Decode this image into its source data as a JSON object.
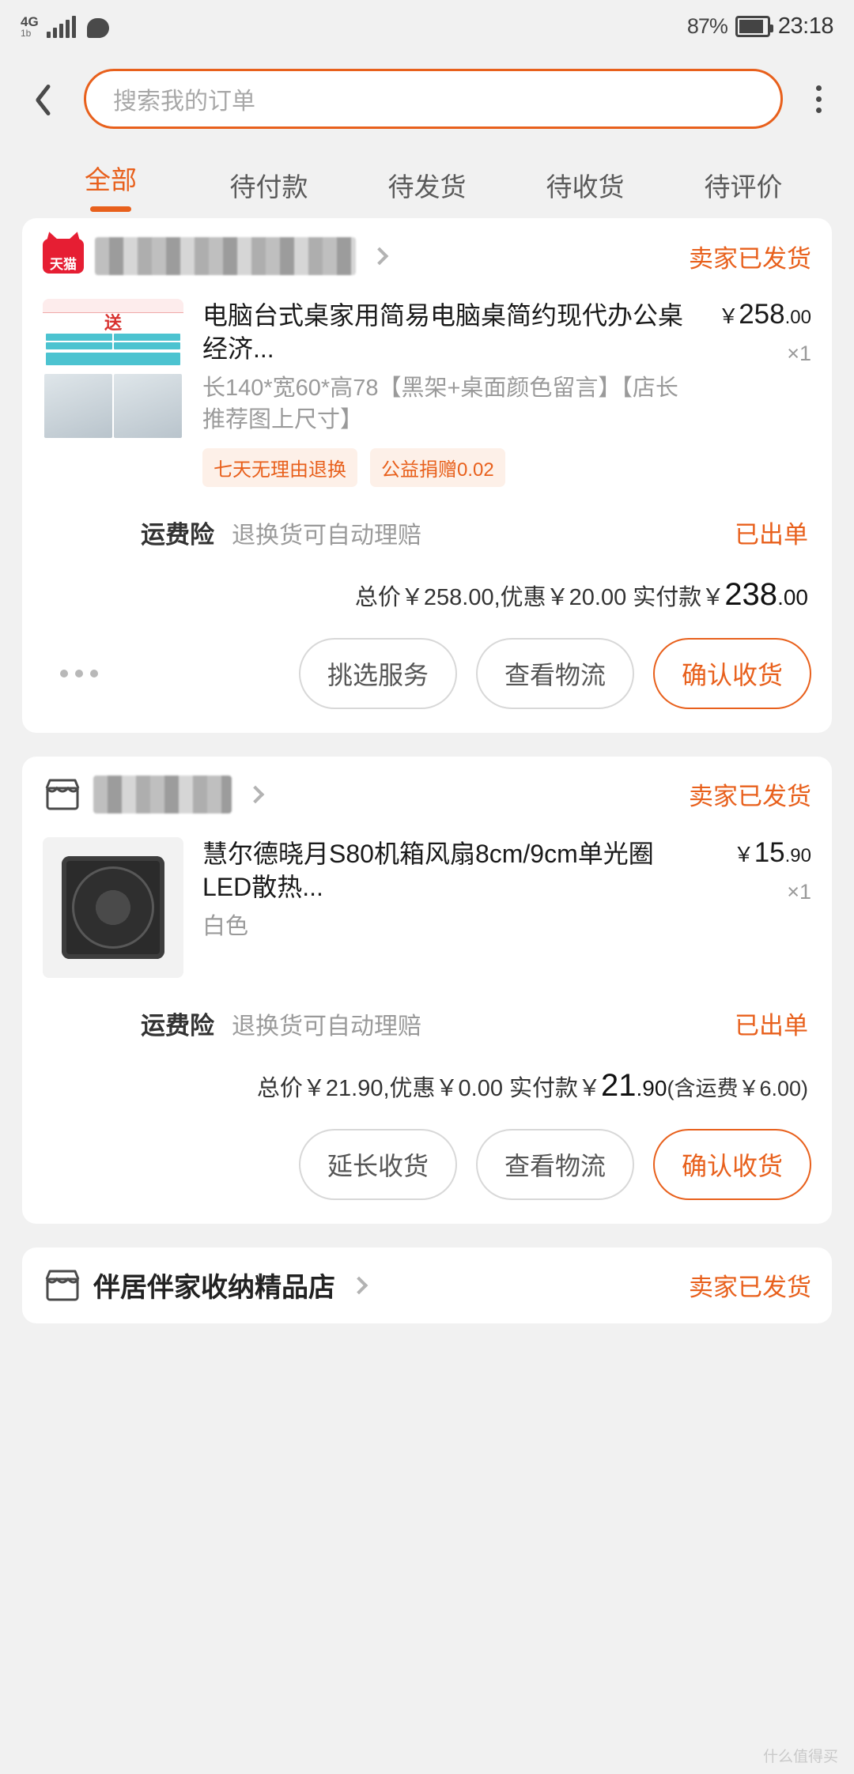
{
  "status_bar": {
    "network": "4G",
    "network_sub": "1b",
    "battery_percent": "87%",
    "battery_level": 87,
    "time": "23:18"
  },
  "header": {
    "back_icon": "back-arrow-icon",
    "search_placeholder": "搜索我的订单",
    "menu_icon": "kebab-menu-icon",
    "accent_color": "#e8601c"
  },
  "tabs": [
    {
      "label": "全部",
      "active": true
    },
    {
      "label": "待付款",
      "active": false
    },
    {
      "label": "待发货",
      "active": false
    },
    {
      "label": "待收货",
      "active": false
    },
    {
      "label": "待评价",
      "active": false
    }
  ],
  "orders": [
    {
      "shop": {
        "badge": "tmall-badge",
        "badge_text": "天猫",
        "name_hidden": true,
        "status": "卖家已发货"
      },
      "product": {
        "title": "电脑台式桌家用简易电脑桌简约现代办公桌经济...",
        "spec": "长140*宽60*高78【黑架+桌面颜色留言】【店长推荐图上尺寸】",
        "price_yen": "￥",
        "price_int": "258",
        "price_cents": ".00",
        "qty": "×1",
        "tags": [
          "七天无理由退换",
          "公益捐赠0.02"
        ]
      },
      "insurance": {
        "title": "运费险",
        "desc": "退换货可自动理赔",
        "state": "已出单"
      },
      "totals": {
        "prefix": "总价￥258.00,优惠￥20.00 实付款￥",
        "paid_int": "238",
        "paid_cents": ".00",
        "shipping_note": ""
      },
      "actions": {
        "more": "more-options",
        "buttons": [
          "挑选服务",
          "查看物流"
        ],
        "primary": "确认收货"
      }
    },
    {
      "shop": {
        "badge": "store-icon",
        "badge_text": "",
        "name_hidden": true,
        "status": "卖家已发货"
      },
      "product": {
        "title": "慧尔德晓月S80机箱风扇8cm/9cm单光圈LED散热...",
        "spec": "白色",
        "price_yen": "￥",
        "price_int": "15",
        "price_cents": ".90",
        "qty": "×1",
        "tags": []
      },
      "insurance": {
        "title": "运费险",
        "desc": "退换货可自动理赔",
        "state": "已出单"
      },
      "totals": {
        "prefix": "总价￥21.90,优惠￥0.00 实付款￥",
        "paid_int": "21",
        "paid_cents": ".90",
        "shipping_note": "(含运费￥6.00)"
      },
      "actions": {
        "more": "",
        "buttons": [
          "延长收货",
          "查看物流"
        ],
        "primary": "确认收货"
      }
    },
    {
      "shop": {
        "badge": "store-icon",
        "badge_text": "",
        "name_hidden": false,
        "name": "伴居伴家收纳精品店",
        "status": "卖家已发货"
      }
    }
  ],
  "watermark": "什么值得买"
}
